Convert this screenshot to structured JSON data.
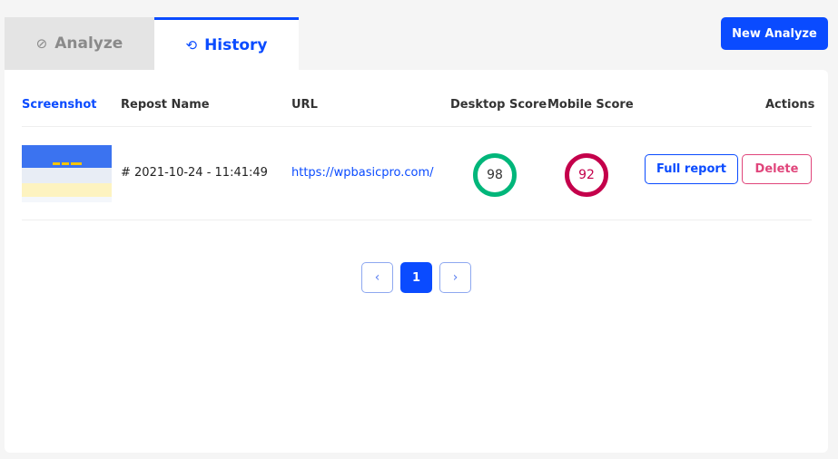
{
  "tabs": [
    {
      "label": "Analyze",
      "icon": "compass-icon"
    },
    {
      "label": "History",
      "icon": "history-icon",
      "active": true
    }
  ],
  "new_analyze_label": "New Analyze",
  "table": {
    "headers": [
      "Screenshot",
      "Repost Name",
      "URL",
      "Desktop Score",
      "Mobile Score",
      "Actions"
    ],
    "rows": [
      {
        "name": "# 2021-10-24  -  11:41:49",
        "url": "https://wpbasicpro.com/",
        "desktop_score": "98",
        "mobile_score": "92",
        "full_report": "Full report",
        "delete": "Delete"
      }
    ]
  },
  "pagination": {
    "current": "1"
  },
  "colors": {
    "accent": "#0a4bff",
    "good": "#00b67a",
    "bad": "#c4004b",
    "delete": "#e0457b"
  }
}
